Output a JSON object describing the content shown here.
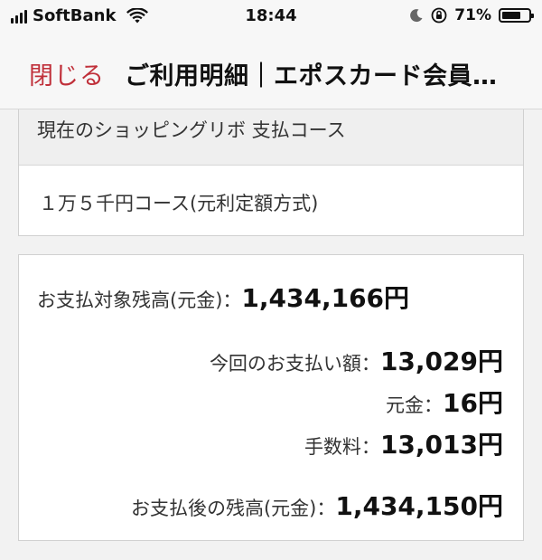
{
  "status_bar": {
    "carrier": "SoftBank",
    "time": "18:44",
    "battery_percent": "71%",
    "battery_level": 0.71
  },
  "nav": {
    "close_label": "閉じる",
    "title": "ご利用明細｜エポスカード会員…"
  },
  "course": {
    "header": "現在のショッピングリボ 支払コース",
    "value": "１万５千円コース(元利定額方式)"
  },
  "balance": {
    "target_label": "お支払対象残高(元金)：",
    "target_value": "1,434,166円",
    "payment_label": "今回のお支払い額：",
    "payment_value": "13,029円",
    "principal_label": "元金：",
    "principal_value": "16円",
    "fee_label": "手数料：",
    "fee_value": "13,013円",
    "after_label": "お支払後の残高(元金)：",
    "after_value": "1,434,150円"
  },
  "colors": {
    "accent": "#c0303a"
  }
}
